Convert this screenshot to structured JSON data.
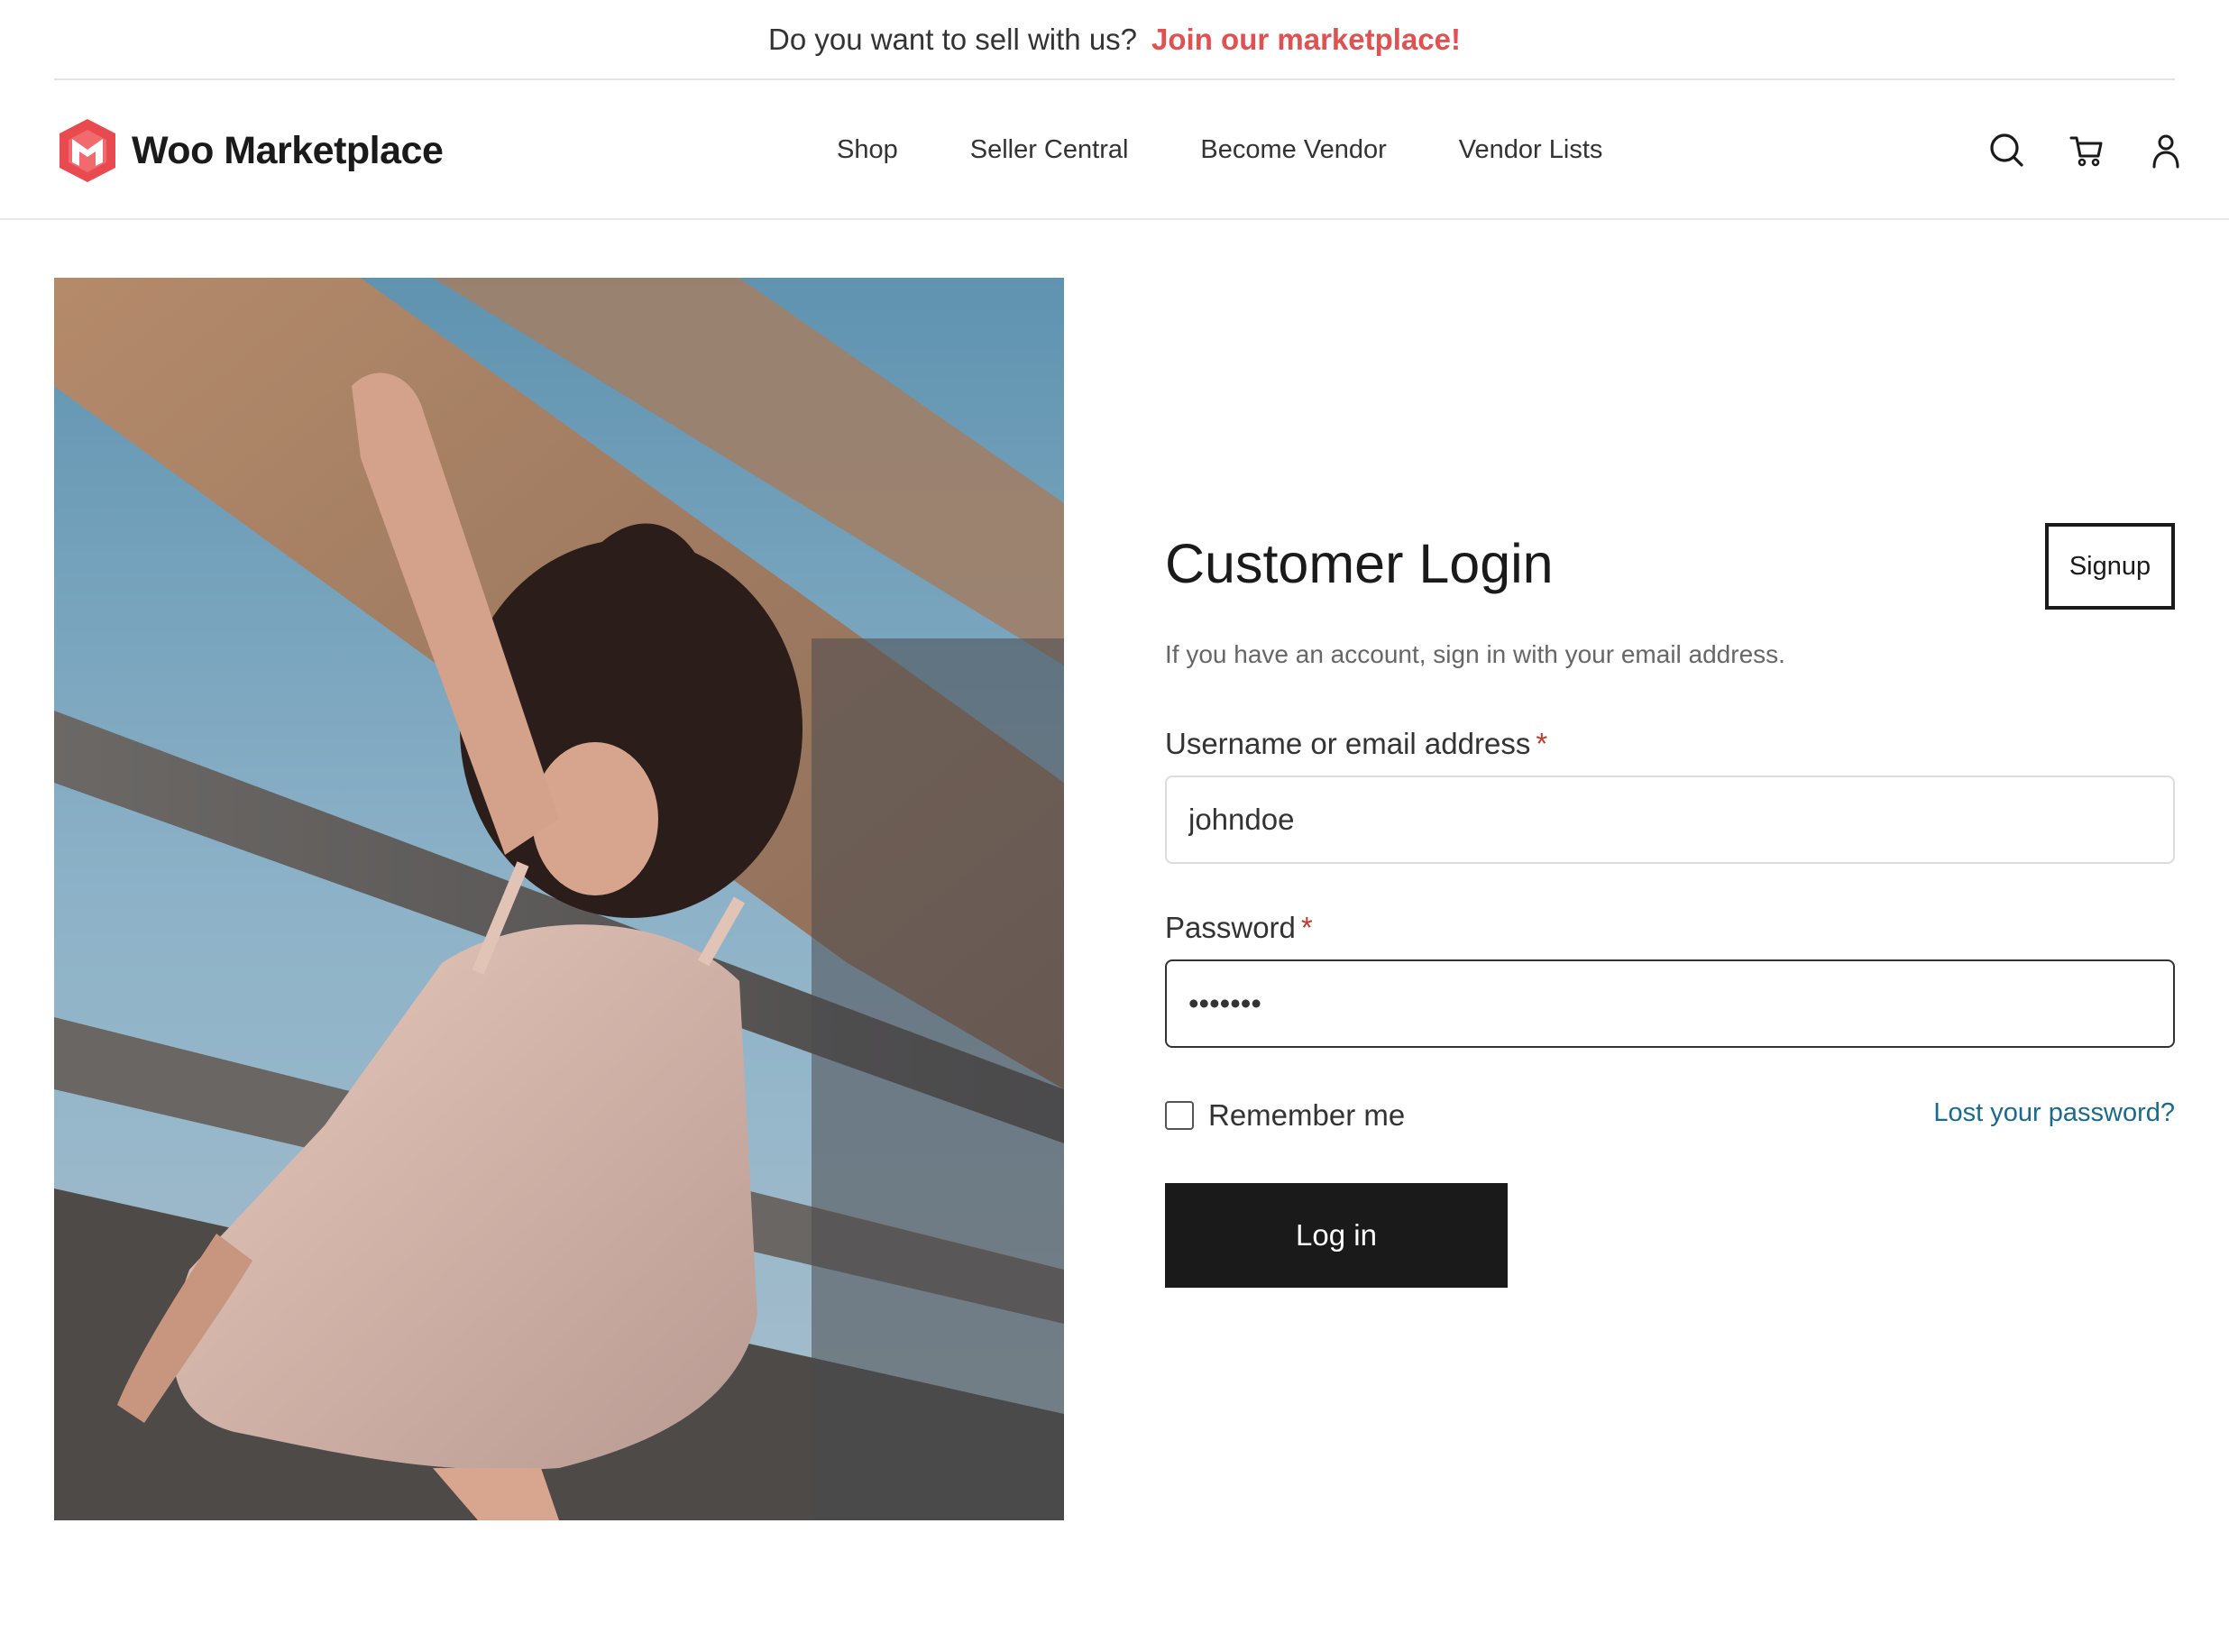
{
  "topbar": {
    "question": "Do you want to sell with us?",
    "link_label": "Join our marketplace!"
  },
  "brand": {
    "name": "Woo Marketplace",
    "accent_color": "#e84a4f"
  },
  "nav": {
    "items": [
      {
        "label": "Shop"
      },
      {
        "label": "Seller Central"
      },
      {
        "label": "Become Vendor"
      },
      {
        "label": "Vendor Lists"
      }
    ]
  },
  "header_icons": [
    "search-icon",
    "cart-icon",
    "account-icon"
  ],
  "hero": {
    "icon": "hero-photo"
  },
  "login": {
    "title": "Customer Login",
    "signup_label": "Signup",
    "subtitle": "If you have an account, sign in with your email address.",
    "username_label": "Username or email address",
    "username_value": "johndoe",
    "password_label": "Password",
    "password_value": "•••••••",
    "required_mark": "*",
    "remember_label": "Remember me",
    "remember_checked": false,
    "lost_password_label": "Lost your password?",
    "login_button": "Log in"
  },
  "colors": {
    "accent_red": "#e05151",
    "link_blue": "#1a6a8e",
    "button_dark": "#1a1a1a"
  }
}
